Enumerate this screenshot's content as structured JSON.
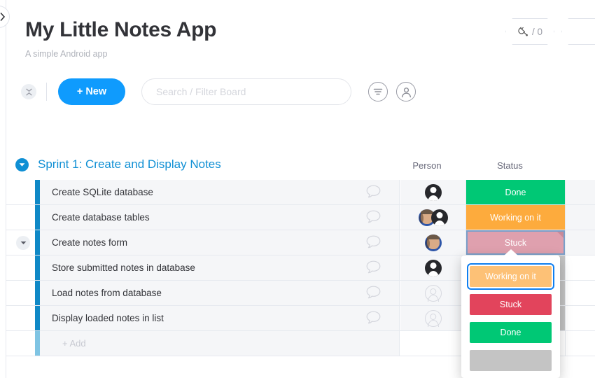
{
  "header": {
    "title": "My Little Notes App",
    "subtitle": "A simple Android app",
    "badge_count": "/ 0",
    "integration_icon": "plug-icon",
    "expand_sidebar_icon": "chevron-right-icon"
  },
  "toolbar": {
    "collapse_icon": "collapse-vertical-icon",
    "new_label": "+ New",
    "search_placeholder": "Search / Filter Board",
    "search_value": "",
    "filter_icon": "filter-icon",
    "person_icon": "person-circle-icon"
  },
  "group": {
    "caret_icon": "caret-down-icon",
    "title": "Sprint 1: Create and Display Notes",
    "color": "#0f8fd4"
  },
  "columns": {
    "person": "Person",
    "status": "Status"
  },
  "rows": [
    {
      "name": "Create SQLite database",
      "chat_icon": "comment-icon",
      "person": "dark",
      "person_extra": "",
      "status": "Done",
      "status_color": "#00c875",
      "selected": false
    },
    {
      "name": "Create database tables",
      "chat_icon": "comment-icon",
      "person": "photo",
      "person_extra": "dark",
      "status": "Working on it",
      "status_color": "#fdab3d",
      "selected": false
    },
    {
      "name": "Create notes form",
      "chat_icon": "comment-icon",
      "person": "photo",
      "person_extra": "",
      "status": "Stuck",
      "status_color": "#dfa0ae",
      "selected": true
    },
    {
      "name": "Store submitted notes in database",
      "chat_icon": "comment-icon",
      "person": "dark",
      "person_extra": "",
      "status": "",
      "status_color": "#c4c4c4",
      "selected": false
    },
    {
      "name": "Load notes from database",
      "chat_icon": "comment-icon",
      "person": "empty",
      "person_extra": "",
      "status": "",
      "status_color": "#c4c4c4",
      "selected": false
    },
    {
      "name": "Display loaded notes in list",
      "chat_icon": "comment-icon",
      "person": "empty",
      "person_extra": "",
      "status": "",
      "status_color": "#c4c4c4",
      "selected": false
    }
  ],
  "add_row": {
    "label": "+ Add"
  },
  "status_dropdown": {
    "visible": true,
    "options": [
      {
        "label": "Working on it",
        "color": "#fdc176",
        "focused": true
      },
      {
        "label": "Stuck",
        "color": "#e2445c",
        "focused": false
      },
      {
        "label": "Done",
        "color": "#00c875",
        "focused": false
      },
      {
        "label": "",
        "color": "#c4c4c4",
        "focused": false
      }
    ]
  }
}
